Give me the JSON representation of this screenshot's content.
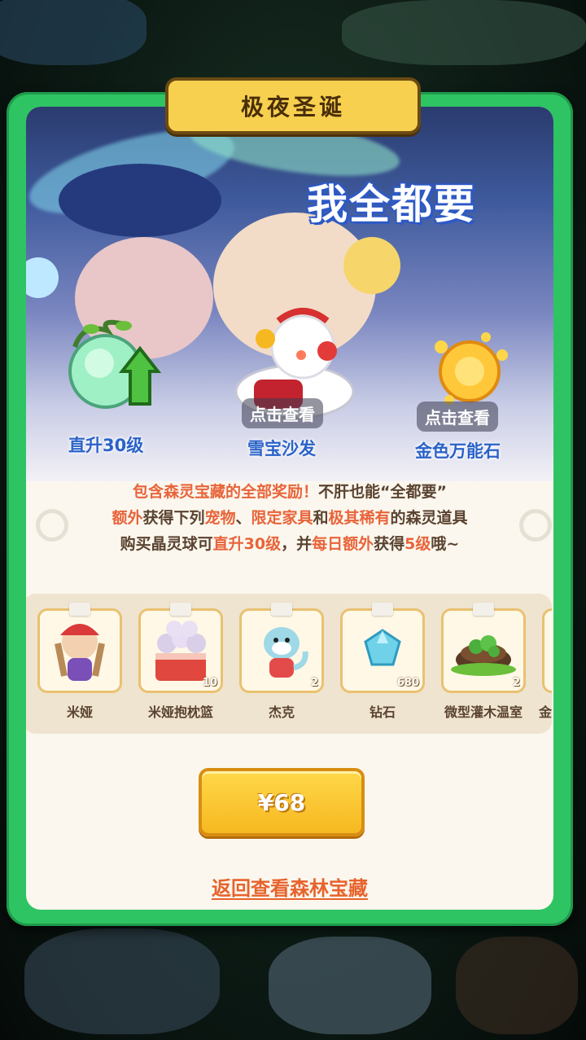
{
  "title": "极夜圣诞",
  "banner": {
    "headline": "我全都要",
    "rewards": [
      {
        "name": "直升30级",
        "tag": "",
        "icon": "crystal-ball-level-up-icon"
      },
      {
        "name": "雪宝沙发",
        "tag": "点击查看",
        "icon": "snowman-sofa-icon"
      },
      {
        "name": "金色万能石",
        "tag": "点击查看",
        "icon": "golden-stone-icon"
      }
    ]
  },
  "description": {
    "line1_a": "包含森灵宝藏的全部奖励！",
    "line1_b": "不肝也能“全都要”",
    "line2_a": "额外",
    "line2_b": "获得下列",
    "line2_c": "宠物",
    "line2_d": "、",
    "line2_e": "限定家具",
    "line2_f": "和",
    "line2_g": "极其稀有",
    "line2_h": "的森灵道具",
    "line3_a": "购买晶灵球可",
    "line3_b": "直升30级",
    "line3_c": "，并",
    "line3_d": "每日额外",
    "line3_e": "获得",
    "line3_f": "5级",
    "line3_g": "哦~"
  },
  "items": [
    {
      "name": "米娅",
      "count": "",
      "icon": "mia-pet-icon"
    },
    {
      "name": "米娅抱枕篮",
      "count": "10",
      "icon": "pillow-basket-icon"
    },
    {
      "name": "杰克",
      "count": "2",
      "icon": "jack-pet-icon"
    },
    {
      "name": "钻石",
      "count": "680",
      "icon": "diamond-icon"
    },
    {
      "name": "微型灌木温室",
      "count": "2",
      "icon": "shrub-greenhouse-icon"
    },
    {
      "name": "金",
      "count": "",
      "icon": "gold-item-icon"
    }
  ],
  "buy_button": {
    "label": "¥68"
  },
  "back_link": {
    "label": "返回查看森林宝藏"
  },
  "colors": {
    "frame": "#2fc463",
    "accent": "#e8643a",
    "button": "#f6b820"
  }
}
